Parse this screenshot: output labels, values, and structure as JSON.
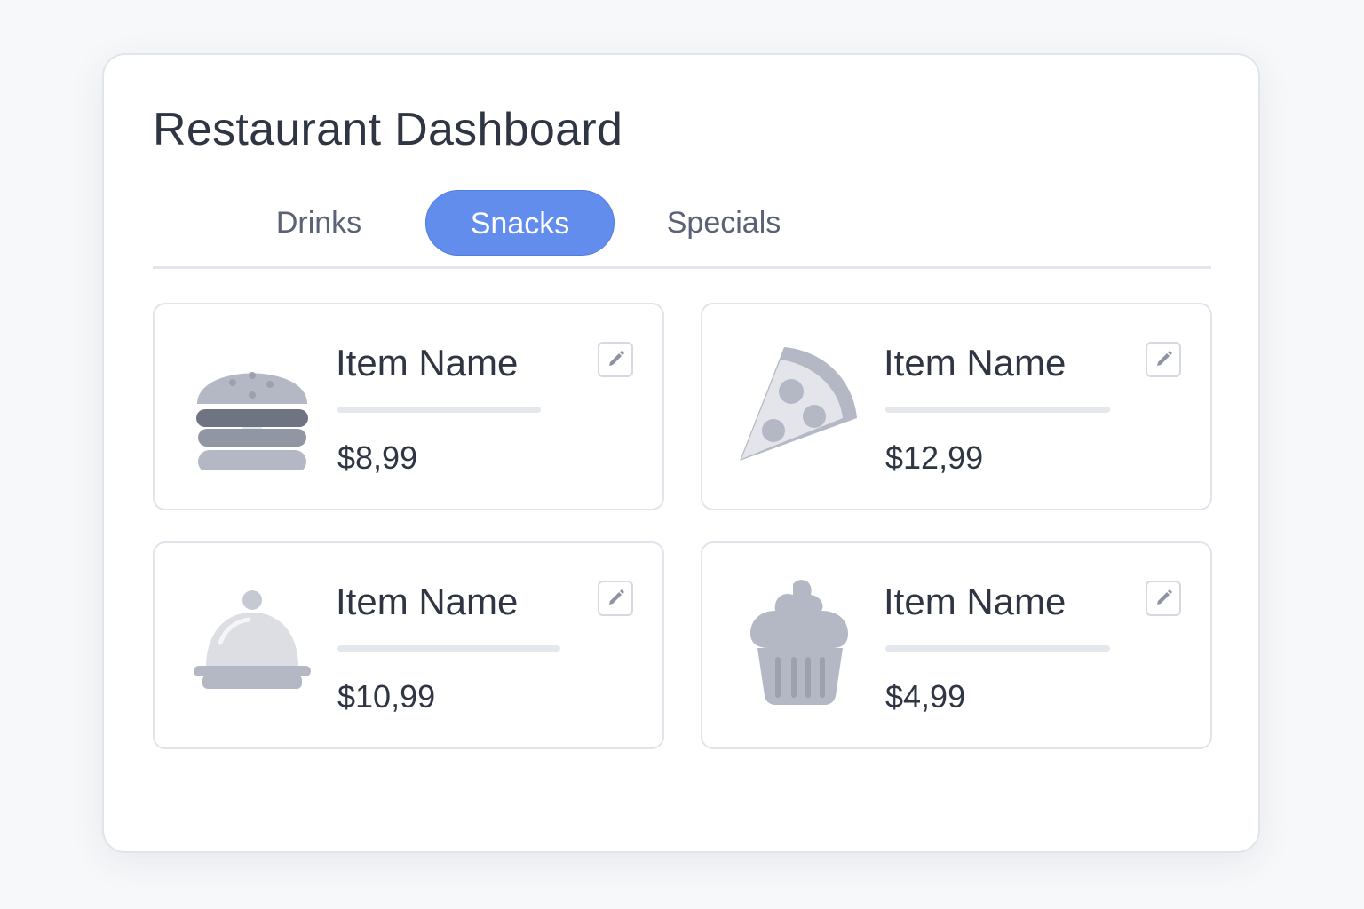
{
  "header": {
    "title": "Restaurant Dashboard"
  },
  "tabs": [
    {
      "label": "Drinks",
      "active": false
    },
    {
      "label": "Snacks",
      "active": true
    },
    {
      "label": "Specials",
      "active": false
    }
  ],
  "colors": {
    "accent": "#638ded",
    "text": "#2f3543",
    "muted": "#5b6275",
    "icon_gray": "#b4b8c4"
  },
  "items": [
    {
      "name": "Item Name",
      "price": "$8,99",
      "icon": "burger-icon",
      "edit_icon": "pencil-icon"
    },
    {
      "name": "Item Name",
      "price": "$12,99",
      "icon": "pizza-slice-icon",
      "edit_icon": "pencil-icon"
    },
    {
      "name": "Item Name",
      "price": "$10,99",
      "icon": "cloche-icon",
      "edit_icon": "pencil-icon"
    },
    {
      "name": "Item Name",
      "price": "$4,99",
      "icon": "cupcake-icon",
      "edit_icon": "pencil-icon"
    }
  ]
}
